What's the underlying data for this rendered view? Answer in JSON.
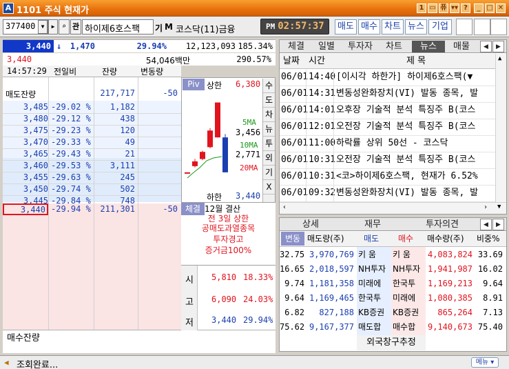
{
  "window": {
    "code": "1101",
    "title": "주식 현재가",
    "logo": "A",
    "buttons": [
      "1",
      "▭",
      "퓨",
      "▾▾",
      "?",
      "_",
      "□",
      "✕"
    ]
  },
  "toolbar": {
    "stock_code": "377400",
    "stock_name": "하이제6호스팩",
    "badge1": "기",
    "badge2": "M",
    "market": "코스닥(11)금융",
    "ampm": "PM",
    "time": "02:57:37",
    "nav": [
      "매도",
      "매수",
      "차트",
      "뉴스",
      "기업"
    ]
  },
  "quote": {
    "price": "3,440",
    "change": "1,470",
    "change_arrow": "↓",
    "change_pct": "29.94%",
    "volume": "12,123,093",
    "vol_ratio": "185.34%",
    "prev_price": "3,440",
    "amount": "54,046백만",
    "turnover": "290.57%"
  },
  "orderbook": {
    "time": "14:57:29",
    "headers": [
      "전일비",
      "잔량",
      "변동량"
    ],
    "sell_total_label": "매도잔량",
    "sell_total": "217,717",
    "sell_total_delta": "-50",
    "asks": [
      [
        "3,485",
        "-29.02 %",
        "1,182"
      ],
      [
        "3,480",
        "-29.12 %",
        "438"
      ],
      [
        "3,475",
        "-29.23 %",
        "120"
      ],
      [
        "3,470",
        "-29.33 %",
        "49"
      ],
      [
        "3,465",
        "-29.43 %",
        "21"
      ],
      [
        "3,460",
        "-29.53 %",
        "3,111"
      ],
      [
        "3,455",
        "-29.63 %",
        "245"
      ],
      [
        "3,450",
        "-29.74 %",
        "502"
      ],
      [
        "3,445",
        "-29.84 %",
        "748"
      ]
    ],
    "bid_top": [
      "3,440",
      "-29.94 %",
      "211,301",
      "-50"
    ],
    "buy_total_label": "매수잔량"
  },
  "chart": {
    "piv": "Piv",
    "upper_label": "상한",
    "upper": "6,380",
    "ma5_label": "5MA",
    "ma5": "3,456",
    "ma10_label": "10MA",
    "ma10": "2,771",
    "ma20_label": "20MA",
    "lower_label": "하한",
    "lower": "3,440",
    "side_tabs": [
      "수",
      "도",
      "차",
      "뉴",
      "투",
      "외",
      "기",
      "X"
    ]
  },
  "chart_data": {
    "type": "candlestick",
    "candles": [
      {
        "open": 3440,
        "close": 3440,
        "high": 3440,
        "low": 3440,
        "dir": "flat"
      },
      {
        "open": 3700,
        "close": 3900,
        "high": 4000,
        "low": 3650,
        "dir": "up"
      },
      {
        "open": 4000,
        "close": 4300,
        "high": 4350,
        "low": 3950,
        "dir": "up"
      },
      {
        "open": 4500,
        "close": 5200,
        "high": 5300,
        "low": 4450,
        "dir": "up"
      },
      {
        "open": 4910,
        "close": 6380,
        "high": 6380,
        "low": 4900,
        "dir": "up"
      },
      {
        "open": 4910,
        "close": 3440,
        "high": 5050,
        "low": 3440,
        "dir": "down"
      }
    ]
  },
  "notice": {
    "tag": "체결",
    "lines": [
      "12월 결산",
      "전 3일 상한",
      "공매도과열종목",
      "투자경고",
      "증거금100%"
    ]
  },
  "stats": [
    {
      "label": "시",
      "value": "5,810",
      "pct": "18.33%"
    },
    {
      "label": "고",
      "value": "6,090",
      "pct": "24.03%"
    },
    {
      "label": "저",
      "value": "3,440",
      "pct": "29.94%"
    }
  ],
  "news": {
    "tabs": [
      "체결",
      "일별",
      "투자자",
      "차트",
      "뉴스",
      "매물"
    ],
    "col_date": "날짜",
    "col_time": "시간",
    "col_title": "제 목",
    "rows": [
      [
        "06/01",
        "14:40",
        "[이시각 하한가] 하이제6호스팩(▼"
      ],
      [
        "06/01",
        "14:31",
        "변동성완화장치(VI) 발동 종목, 발"
      ],
      [
        "06/01",
        "14:01",
        "오후장 기술적 분석 특징주 B(코스"
      ],
      [
        "06/01",
        "12:01",
        "오전장 기술적 분석 특징주 B(코스"
      ],
      [
        "06/01",
        "11:00",
        "하락률 상위 50선 - 코스닥"
      ],
      [
        "06/01",
        "10:31",
        "오전장 기술적 분석 특징주 B(코스"
      ],
      [
        "06/01",
        "10:31",
        "<코>하이제6호스팩, 현재가 6.52%"
      ],
      [
        "06/01",
        "09:32",
        "변동성완화장치(VI) 발동 종목, 발"
      ]
    ]
  },
  "broker": {
    "tabs": [
      "상세",
      "재무",
      "투자의견"
    ],
    "headers": [
      "변동",
      "매도량(주)",
      "매도",
      "매수",
      "매수량(주)",
      "비중%"
    ],
    "rows": [
      [
        "32.75",
        "3,970,769",
        "키 움",
        "키 움",
        "4,083,824",
        "33.69"
      ],
      [
        "16.65",
        "2,018,597",
        "NH투자",
        "NH투자",
        "1,941,987",
        "16.02"
      ],
      [
        "9.74",
        "1,181,358",
        "미래에",
        "한국투",
        "1,169,213",
        "9.64"
      ],
      [
        "9.64",
        "1,169,465",
        "한국투",
        "미래에",
        "1,080,385",
        "8.91"
      ],
      [
        "6.82",
        "827,188",
        "KB증권",
        "KB증권",
        "865,264",
        "7.13"
      ],
      [
        "75.62",
        "9,167,377",
        "매도합",
        "매수합",
        "9,140,673",
        "75.40"
      ]
    ],
    "foreign": "외국창구추정"
  },
  "status": {
    "text": "조회완료...",
    "menu": "메뉴 ▾"
  }
}
